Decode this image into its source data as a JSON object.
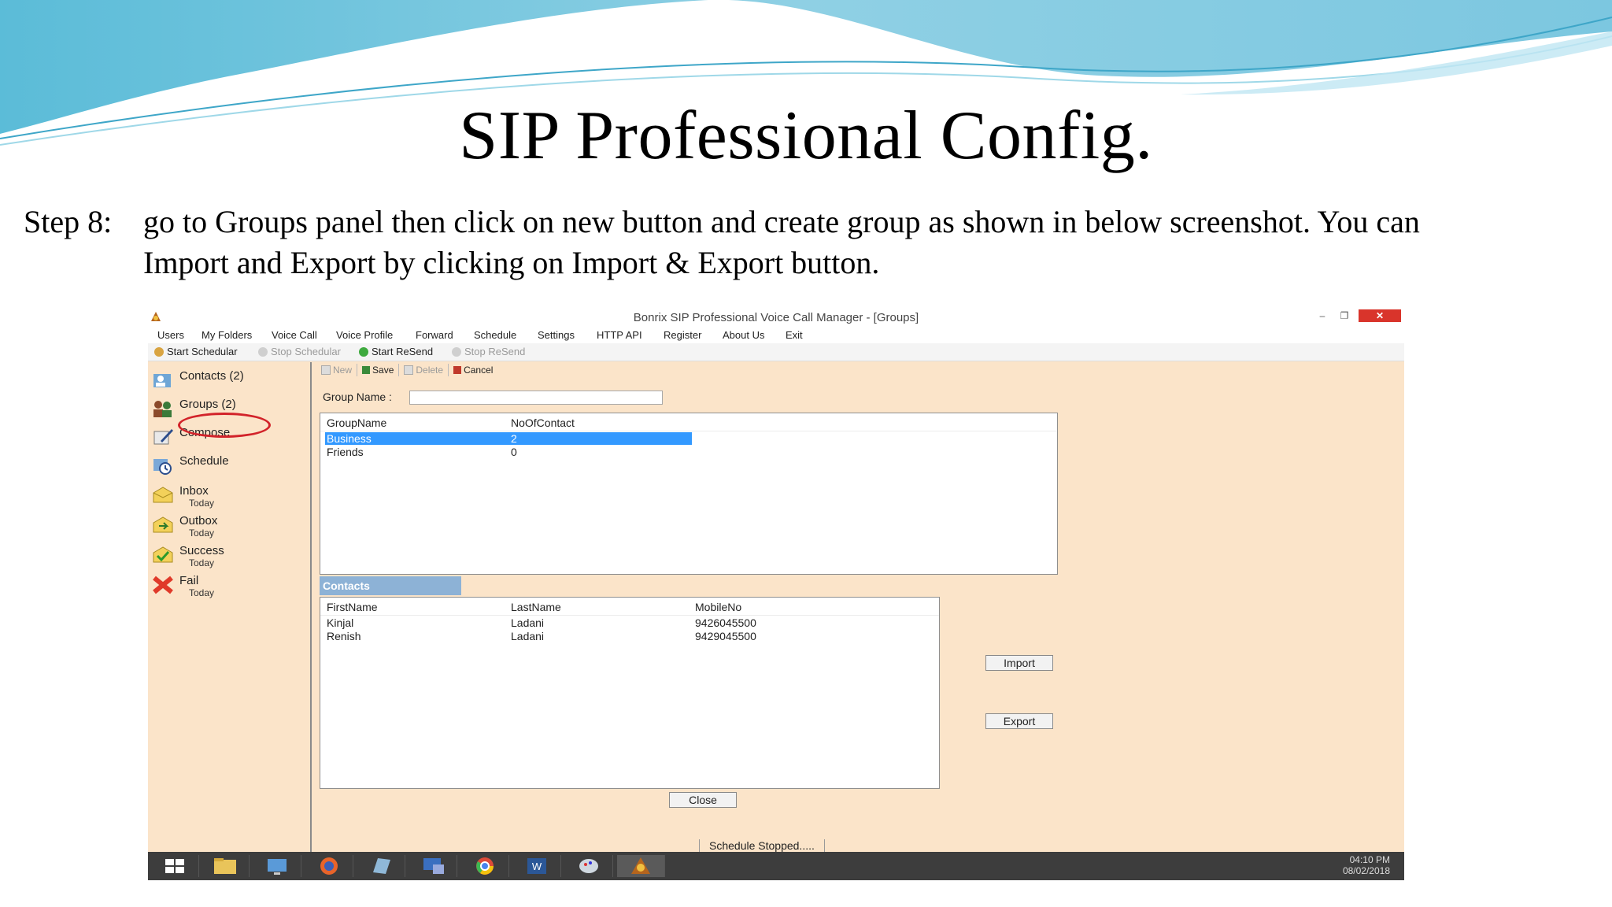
{
  "slide": {
    "title": "SIP  Professional Config.",
    "step_label": "Step 8:",
    "step_line1": "go to Groups panel then click on new button and create group  as shown in below screenshot. You  can",
    "step_line2": "Import and Export by clicking on Import & Export button."
  },
  "window": {
    "title": "Bonrix SIP Professional Voice Call Manager - [Groups]",
    "minimize": "–",
    "maximize": "❐",
    "close": "✕"
  },
  "menu": [
    "Users",
    "My Folders",
    "Voice Call",
    "Voice Profile",
    "Forward",
    "Schedule",
    "Settings",
    "HTTP API",
    "Register",
    "About Us",
    "Exit"
  ],
  "toolbar": {
    "start_scheduler": "Start Schedular",
    "stop_scheduler": "Stop Schedular",
    "start_resend": "Start ReSend",
    "stop_resend": "Stop ReSend"
  },
  "sidebar": {
    "contacts": "Contacts (2)",
    "groups": "Groups (2)",
    "compose": "Compose",
    "schedule": "Schedule",
    "inbox": "Inbox",
    "outbox": "Outbox",
    "success": "Success",
    "fail": "Fail",
    "today": "Today"
  },
  "form": {
    "new": "New",
    "save": "Save",
    "delete": "Delete",
    "cancel": "Cancel",
    "group_name_label": "Group Name :",
    "group_name_value": ""
  },
  "groups_table": {
    "headers": [
      "GroupName",
      "NoOfContact"
    ],
    "rows": [
      {
        "name": "Business",
        "count": "2"
      },
      {
        "name": "Friends",
        "count": "0"
      }
    ]
  },
  "contacts_table": {
    "tab": "Contacts",
    "headers": [
      "FirstName",
      "LastName",
      "MobileNo"
    ],
    "rows": [
      {
        "first": "Kinjal",
        "last": "Ladani",
        "mobile": "9426045500"
      },
      {
        "first": "Renish",
        "last": "Ladani",
        "mobile": "9429045500"
      }
    ]
  },
  "buttons": {
    "import": "Import",
    "export": "Export",
    "close": "Close"
  },
  "status": "Schedule Stopped.....",
  "tray": {
    "time": "04:10 PM",
    "date": "08/02/2018"
  },
  "colors": {
    "panel_bg": "#fbe4c9",
    "selection": "#3399ff",
    "contacts_tab": "#8db2d6",
    "close_button": "#d9342b",
    "taskbar": "#3d3d3d",
    "highlight_ring": "#d2232a"
  }
}
